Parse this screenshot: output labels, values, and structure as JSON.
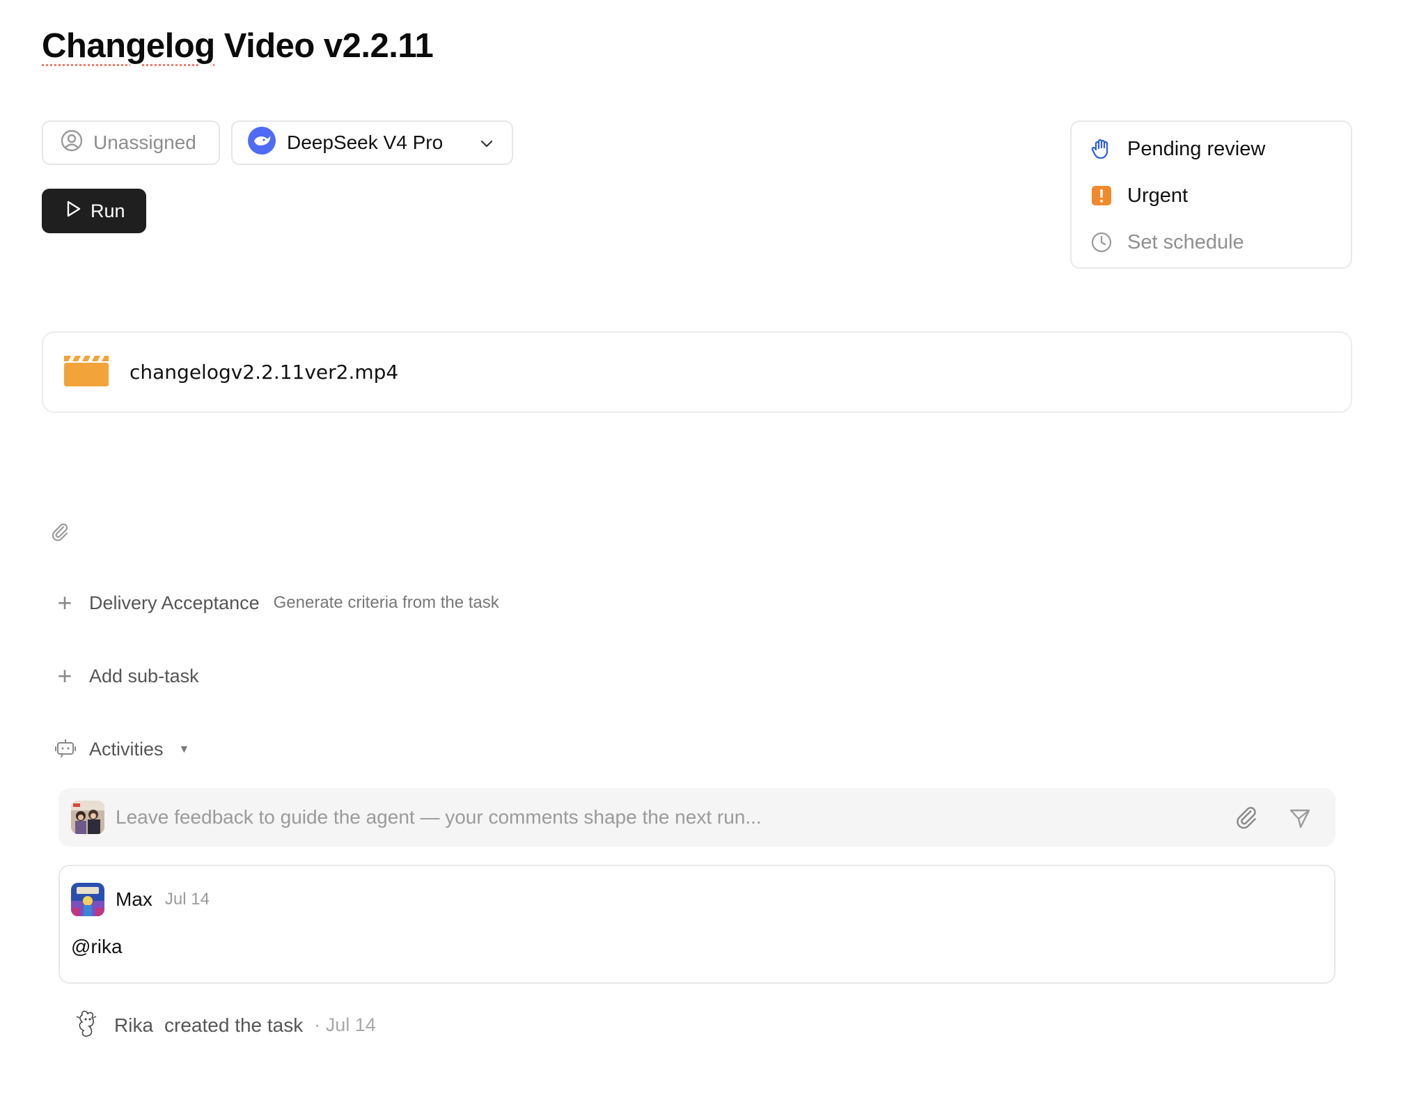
{
  "task": {
    "title_part1": "Changelog",
    "title_part2": " Video v2.2.11"
  },
  "assignee": {
    "label": "Unassigned",
    "icon": "user-circle-icon"
  },
  "model": {
    "label": "DeepSeek V4 Pro",
    "icon": "deepseek-whale-icon",
    "accent": "#4f6bf5"
  },
  "run_button": {
    "label": "Run"
  },
  "side_panel": {
    "status": {
      "label": "Pending review",
      "icon": "hand-icon",
      "color": "#2f5fe0"
    },
    "priority": {
      "label": "Urgent",
      "icon": "exclamation-square-icon",
      "color": "#f08a2c"
    },
    "schedule": {
      "label": "Set schedule",
      "icon": "clock-icon"
    }
  },
  "attachment": {
    "file_name": "changelogv2.2.11ver2.mp4",
    "icon": "clapperboard-icon",
    "color": "#f2a33a"
  },
  "delivery": {
    "label": "Delivery Acceptance",
    "hint": "Generate criteria from the task"
  },
  "subtask": {
    "label": "Add sub-task"
  },
  "activities": {
    "label": "Activities",
    "caret": "▼"
  },
  "comment_box": {
    "placeholder": "Leave feedback to guide the agent — your comments shape the next run..."
  },
  "comments": [
    {
      "author": "Max",
      "date": "Jul 14",
      "body": "@rika"
    }
  ],
  "activity_log": [
    {
      "actor": "Rika",
      "action": "created the task",
      "date": "· Jul 14"
    }
  ]
}
